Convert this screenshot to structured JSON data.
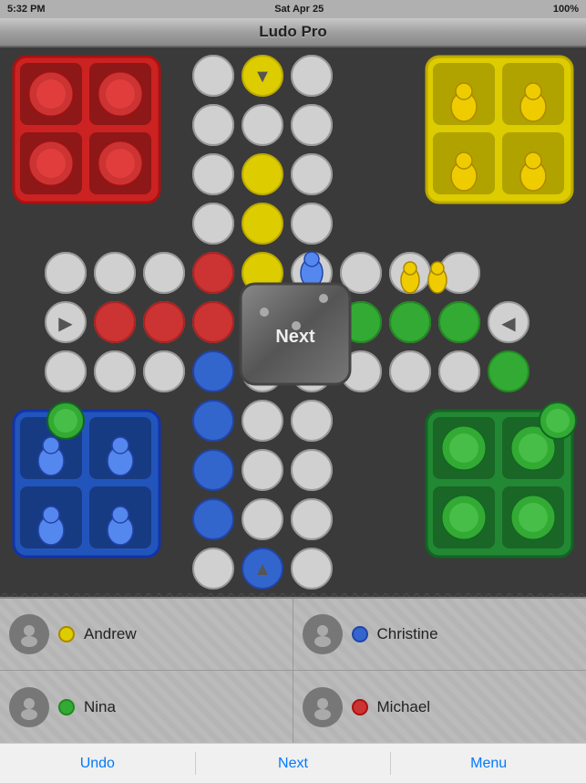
{
  "app": {
    "title": "Ludo Pro",
    "status_time": "5:32 PM",
    "status_day": "Sat Apr 25",
    "battery": "100%"
  },
  "board": {
    "center_button_label": "Next",
    "arrows": {
      "top": "▼",
      "left": "▶",
      "right": "◀",
      "bottom": "▲"
    }
  },
  "players": [
    {
      "id": "andrew",
      "name": "Andrew",
      "token_color": "#ddcc00",
      "color_label": "yellow",
      "avatar": "person"
    },
    {
      "id": "christine",
      "name": "Christine",
      "token_color": "#3366cc",
      "color_label": "blue",
      "avatar": "person"
    },
    {
      "id": "nina",
      "name": "Nina",
      "token_color": "#33aa33",
      "color_label": "green",
      "avatar": "person"
    },
    {
      "id": "michael",
      "name": "Michael",
      "token_color": "#cc3333",
      "color_label": "red",
      "avatar": "person"
    }
  ],
  "toolbar": {
    "undo_label": "Undo",
    "next_label": "Next",
    "menu_label": "Menu"
  }
}
